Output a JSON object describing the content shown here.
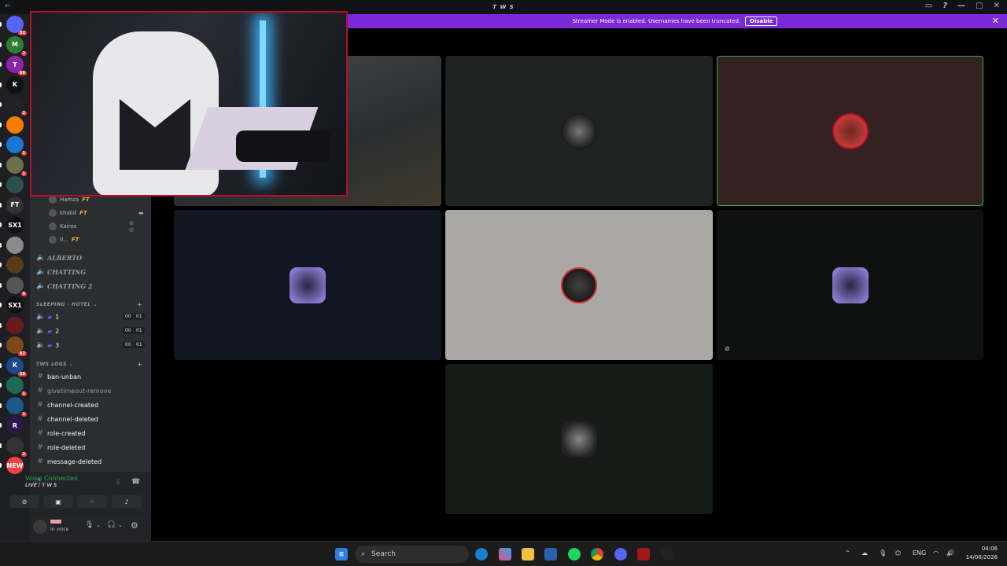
{
  "window": {
    "title": "T W S",
    "back": "←",
    "controls": [
      "▭",
      "?",
      "—",
      "▢",
      "✕"
    ]
  },
  "banner": {
    "message": "Streamer Mode is enabled. Usernames have been truncated.",
    "disable_label": "Disable",
    "close": "✕"
  },
  "guilds": [
    {
      "text": "",
      "color": "#5865f2",
      "badge": "32"
    },
    {
      "text": "M",
      "color": "#2e7d32",
      "badge": "2"
    },
    {
      "text": "T",
      "color": "#8e24aa",
      "badge": "69"
    },
    {
      "text": "K",
      "color": "#111111",
      "badge": ""
    },
    {
      "text": "",
      "color": "#222222",
      "badge": "2"
    },
    {
      "text": "",
      "color": "#f57c00",
      "badge": ""
    },
    {
      "text": "",
      "color": "#1976d2",
      "badge": "1"
    },
    {
      "text": "",
      "color": "#6d6d4a",
      "badge": "1"
    },
    {
      "text": "",
      "color": "#2f4f4f",
      "badge": ""
    },
    {
      "text": "FT",
      "color": "#333333",
      "badge": ""
    },
    {
      "text": "SX1",
      "color": "#111111",
      "badge": ""
    },
    {
      "text": "",
      "color": "#8a8a8a",
      "badge": ""
    },
    {
      "text": "",
      "color": "#5a3a1a",
      "badge": ""
    },
    {
      "text": "",
      "color": "#555555",
      "badge": "9"
    },
    {
      "text": "SX1",
      "color": "#111111",
      "badge": ""
    },
    {
      "text": "",
      "color": "#6b1a1a",
      "badge": ""
    },
    {
      "text": "",
      "color": "#7a4a1a",
      "badge": "47"
    },
    {
      "text": "K",
      "color": "#1a4a8a",
      "badge": "28"
    },
    {
      "text": "",
      "color": "#1a6a5a",
      "badge": "1"
    },
    {
      "text": "",
      "color": "#1a5a8a",
      "badge": "1"
    },
    {
      "text": "R",
      "color": "#2a1a4a",
      "badge": ""
    },
    {
      "text": "",
      "color": "#333333",
      "badge": "2"
    },
    {
      "text": "NEW",
      "color": "#f23f43",
      "badge": ""
    }
  ],
  "members": [
    {
      "name": "Hamza",
      "tag": "FT"
    },
    {
      "name": "khalid",
      "tag": "FT"
    },
    {
      "name": "Kairox",
      "tag": ""
    },
    {
      "name": "II...",
      "tag": "FT"
    }
  ],
  "voice_channels": [
    {
      "name": "ALBERTO"
    },
    {
      "name": "CHATTING"
    },
    {
      "name": "CHATTING 2"
    }
  ],
  "categories": {
    "sleeping": "SLEEPING - HOTEL",
    "logs": "TWS LOGS",
    "plus": "+"
  },
  "hotel_rooms": [
    {
      "name": "1",
      "c1": "00",
      "c2": "01"
    },
    {
      "name": "2",
      "c1": "00",
      "c2": "01"
    },
    {
      "name": "3",
      "c1": "00",
      "c2": "01"
    }
  ],
  "log_channels": [
    {
      "name": "ban-unban",
      "bright": true
    },
    {
      "name": "givetimeout-remove",
      "bright": false
    },
    {
      "name": "channel-created",
      "bright": true
    },
    {
      "name": "channel-deleted",
      "bright": true
    },
    {
      "name": "role-created",
      "bright": true
    },
    {
      "name": "role-deleted",
      "bright": true
    },
    {
      "name": "message-deleted",
      "bright": true
    }
  ],
  "voice": {
    "status": "Voice Connected",
    "channel": "LIVE / T W S"
  },
  "user": {
    "status": "In voice"
  },
  "taskbar": {
    "search_placeholder": "Search",
    "lang": "ENG",
    "time": "04:06",
    "date": "14/08/2026"
  },
  "colors": {
    "accent": "#7a29d8",
    "voice_green": "#23a55a",
    "speaking_border": "#3ba55d",
    "pip_border": "#b2102a"
  }
}
